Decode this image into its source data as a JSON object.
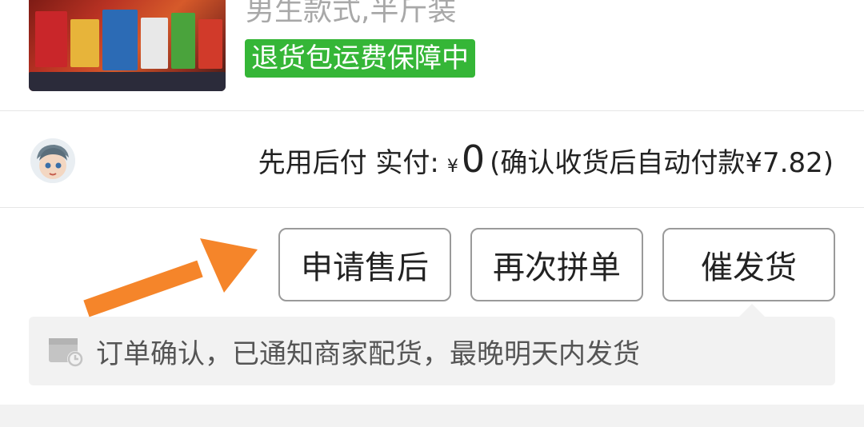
{
  "product": {
    "spec": "男生款式,半斤装",
    "badge": "退货包运费保障中"
  },
  "payment": {
    "label": "先用后付 实付:",
    "currency": "¥",
    "amount": "0",
    "note": "(确认收货后自动付款¥7.82)"
  },
  "actions": {
    "after_sale": "申请售后",
    "regroup": "再次拼单",
    "urge_ship": "催发货"
  },
  "notice": {
    "text": "订单确认，已通知商家配货，最晚明天内发货"
  },
  "colors": {
    "badge_green": "#35b637",
    "arrow_orange": "#f5852a"
  }
}
